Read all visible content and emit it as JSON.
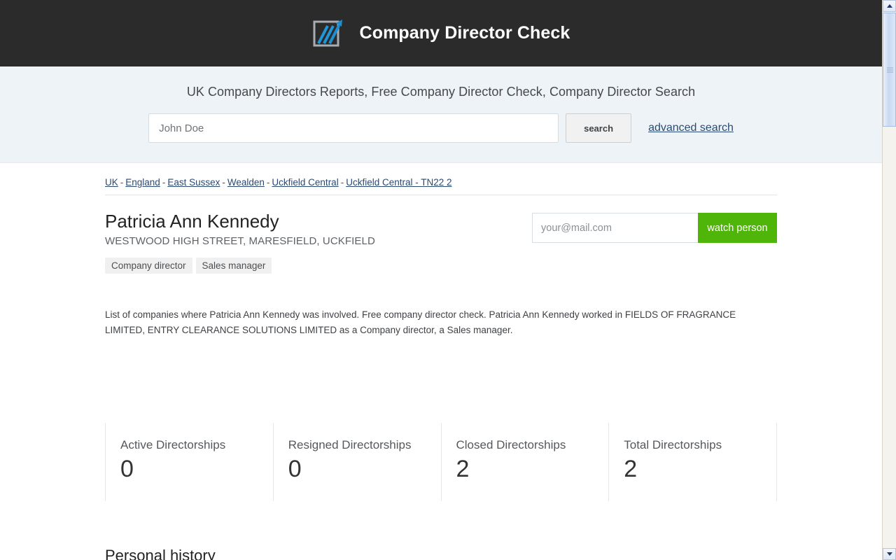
{
  "header": {
    "title": "Company Director Check",
    "logo_icon": "chart-arrow-logo-icon"
  },
  "search": {
    "tagline": "UK Company Directors Reports, Free Company Director Check, Company Director Search",
    "input_placeholder": "John Doe",
    "input_value": "",
    "button_label": "search",
    "advanced_link": "advanced search"
  },
  "breadcrumb": {
    "items": [
      {
        "label": "UK"
      },
      {
        "label": "England"
      },
      {
        "label": "East Sussex"
      },
      {
        "label": "Wealden"
      },
      {
        "label": "Uckfield Central"
      },
      {
        "label": "Uckfield Central - TN22 2"
      }
    ],
    "separator": "-"
  },
  "person": {
    "name": "Patricia Ann Kennedy",
    "address": "WESTWOOD HIGH STREET, MARESFIELD, UCKFIELD",
    "tags": [
      {
        "label": "Company director"
      },
      {
        "label": "Sales manager"
      }
    ]
  },
  "watch": {
    "email_placeholder": "your@mail.com",
    "email_value": "",
    "button_label": "watch person",
    "button_color": "#4fb508"
  },
  "description": "List of companies where Patricia Ann Kennedy was involved. Free company director check. Patricia Ann Kennedy worked in FIELDS OF FRAGRANCE LIMITED, ENTRY CLEARANCE SOLUTIONS LIMITED as a Company director, a Sales manager.",
  "stats": [
    {
      "label": "Active Directorships",
      "value": "0"
    },
    {
      "label": "Resigned Directorships",
      "value": "0"
    },
    {
      "label": "Closed Directorships",
      "value": "2"
    },
    {
      "label": "Total Directorships",
      "value": "2"
    }
  ],
  "sections": {
    "personal_history_heading": "Personal history"
  },
  "theme": {
    "header_bg": "#2b2b2b",
    "search_bg": "#eef3f7",
    "link_color": "#2b4a72",
    "accent_green": "#4fb508"
  }
}
